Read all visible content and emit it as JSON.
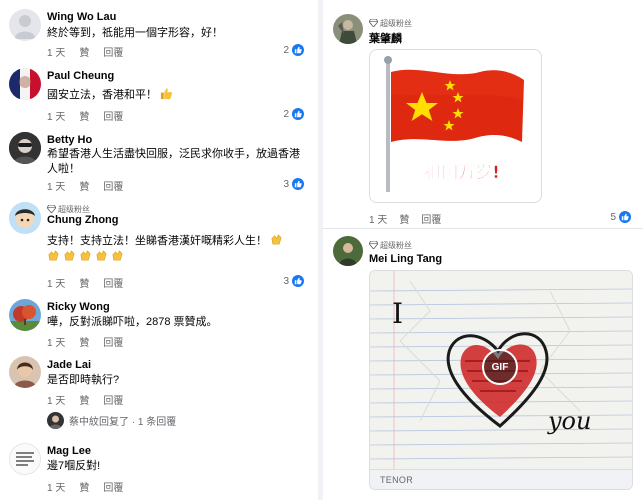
{
  "colors": {
    "like_blue": "#1877f2",
    "meta_gray": "#65676b",
    "name_black": "#050505",
    "flag_red": "#de2910",
    "flag_yellow": "#ffde00",
    "slogan_red": "#d61f1f"
  },
  "left": {
    "comments": [
      {
        "name": "Wing Wo  Lau",
        "text": "終於等到，祗能用一個字形容，好！",
        "like": "1 天",
        "reply": "贊",
        "respond": "回覆",
        "count": "2",
        "avatar_icon": "blank-avatar-icon"
      },
      {
        "name": "Paul Cheung",
        "text": "國安立法，香港和平！",
        "emoji": "thumbs-up-emoji",
        "like": "1 天",
        "reply": "贊",
        "respond": "回覆",
        "count": "2",
        "avatar_icon": "flag-avatar-icon"
      },
      {
        "name": "Betty Ho",
        "text": "希望香港人生活盡快回服，泛民求你收手，放過香港人啦！",
        "like": "1 天",
        "reply": "贊",
        "respond": "回覆",
        "count": "3",
        "avatar_icon": "photo-avatar-icon"
      },
      {
        "badge": "超级粉丝",
        "name": "Chung Zhong",
        "text": "支持！支持立法！坐睇香港漢奸嘅精彩人生！",
        "emoji": "clapping-hands-emoji",
        "like": "1 天",
        "reply": "贊",
        "respond": "回覆",
        "count": "3",
        "avatar_icon": "cartoon-avatar-icon"
      },
      {
        "name": "Ricky Wong",
        "text": "嘩，反對派睇吓啦，2878 票贊成。",
        "like": "1 天",
        "reply": "贊",
        "respond": "回覆",
        "avatar_icon": "tree-avatar-icon"
      },
      {
        "name": "Jade Lai",
        "text": "是否即時執行?",
        "like": "1 天",
        "reply": "贊",
        "respond": "回覆",
        "avatar_icon": "portrait-avatar-icon",
        "reply_summary": "蔡中紋回复了 · 1 条回覆"
      },
      {
        "name": "Mag Lee",
        "text": "邊7嗰反對!",
        "like": "1 天",
        "reply": "贊",
        "respond": "回覆",
        "avatar_icon": "text-avatar-icon"
      }
    ]
  },
  "right": {
    "post1": {
      "badge": "超级粉丝",
      "name": "葉肇麟",
      "sticker_text": "祖国万岁!",
      "like": "1 天",
      "reply": "贊",
      "respond": "回覆",
      "count": "5"
    },
    "post2": {
      "badge": "超级粉丝",
      "name": "Mei Ling Tang",
      "gif_label": "GIF",
      "gif_letter_i": "I",
      "gif_word_you": "you",
      "gif_source": "TENOR"
    }
  }
}
